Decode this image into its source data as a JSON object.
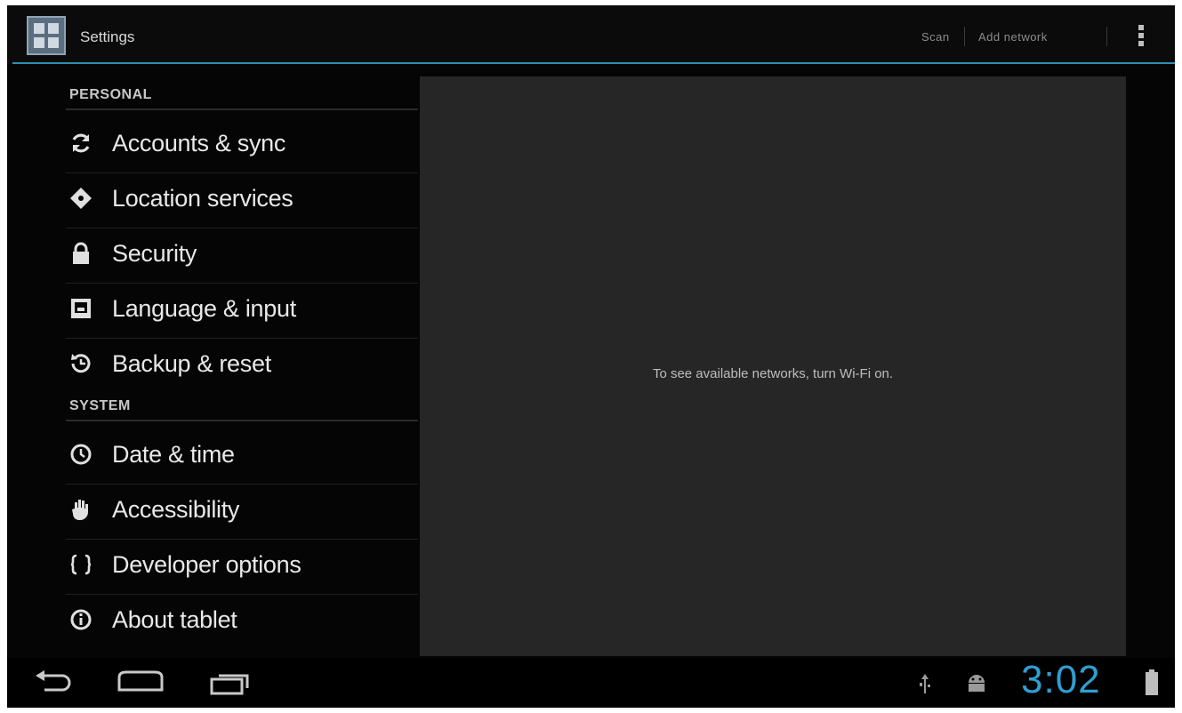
{
  "action_bar": {
    "title": "Settings",
    "actions": [
      "Scan",
      "Add network"
    ],
    "overflow_icon": "overflow-menu-icon"
  },
  "sections": [
    {
      "header": "PERSONAL",
      "items": [
        {
          "label": "Accounts & sync",
          "icon": "sync-icon"
        },
        {
          "label": "Location services",
          "icon": "location-icon"
        },
        {
          "label": "Security",
          "icon": "lock-icon"
        },
        {
          "label": "Language & input",
          "icon": "keyboard-icon"
        },
        {
          "label": "Backup & reset",
          "icon": "backup-icon"
        }
      ]
    },
    {
      "header": "SYSTEM",
      "items": [
        {
          "label": "Date & time",
          "icon": "clock-icon"
        },
        {
          "label": "Accessibility",
          "icon": "hand-icon"
        },
        {
          "label": "Developer options",
          "icon": "braces-icon"
        },
        {
          "label": "About tablet",
          "icon": "info-icon"
        }
      ]
    }
  ],
  "detail": {
    "message": "To see available networks, turn Wi-Fi on."
  },
  "system_bar": {
    "time": "3:02",
    "nav_icons": [
      "back-icon",
      "home-icon",
      "recent-apps-icon"
    ],
    "status_icons": [
      "usb-icon",
      "android-debug-icon",
      "battery-icon"
    ]
  },
  "colors": {
    "accent": "#2f9fd1",
    "background": "#050505",
    "detail_background": "#262626"
  }
}
